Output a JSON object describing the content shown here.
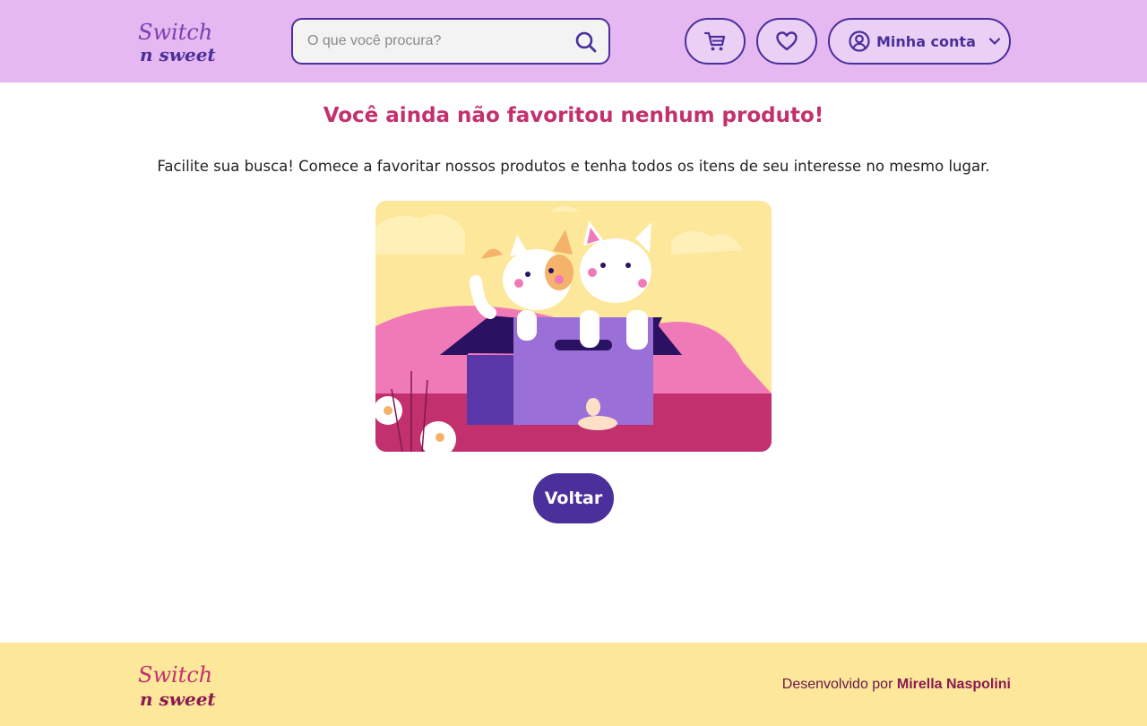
{
  "header": {
    "logo_text_line1": "Switch",
    "logo_text_line2": "n sweet",
    "search": {
      "placeholder": "O que você procura?",
      "value": ""
    },
    "cart_icon": "cart-icon",
    "favorites_icon": "heart-icon",
    "account": {
      "label": "Minha conta",
      "icon": "user-circle-icon",
      "dropdown_icon": "chevron-down-icon"
    }
  },
  "main": {
    "title": "Você ainda não favoritou nenhum produto!",
    "subtitle": "Facilite sua busca! Comece a favoritar nossos produtos e tenha todos os itens de seu interesse no mesmo lugar.",
    "back_label": "Voltar"
  },
  "footer": {
    "credit_prefix": "Desenvolvido por",
    "credit_author": "Mirella Naspolini"
  },
  "colors": {
    "header_bg": "#e5b8f1",
    "accent_purple": "#4b2f9a",
    "title_pink": "#c2316e",
    "footer_bg": "#fde79a"
  }
}
